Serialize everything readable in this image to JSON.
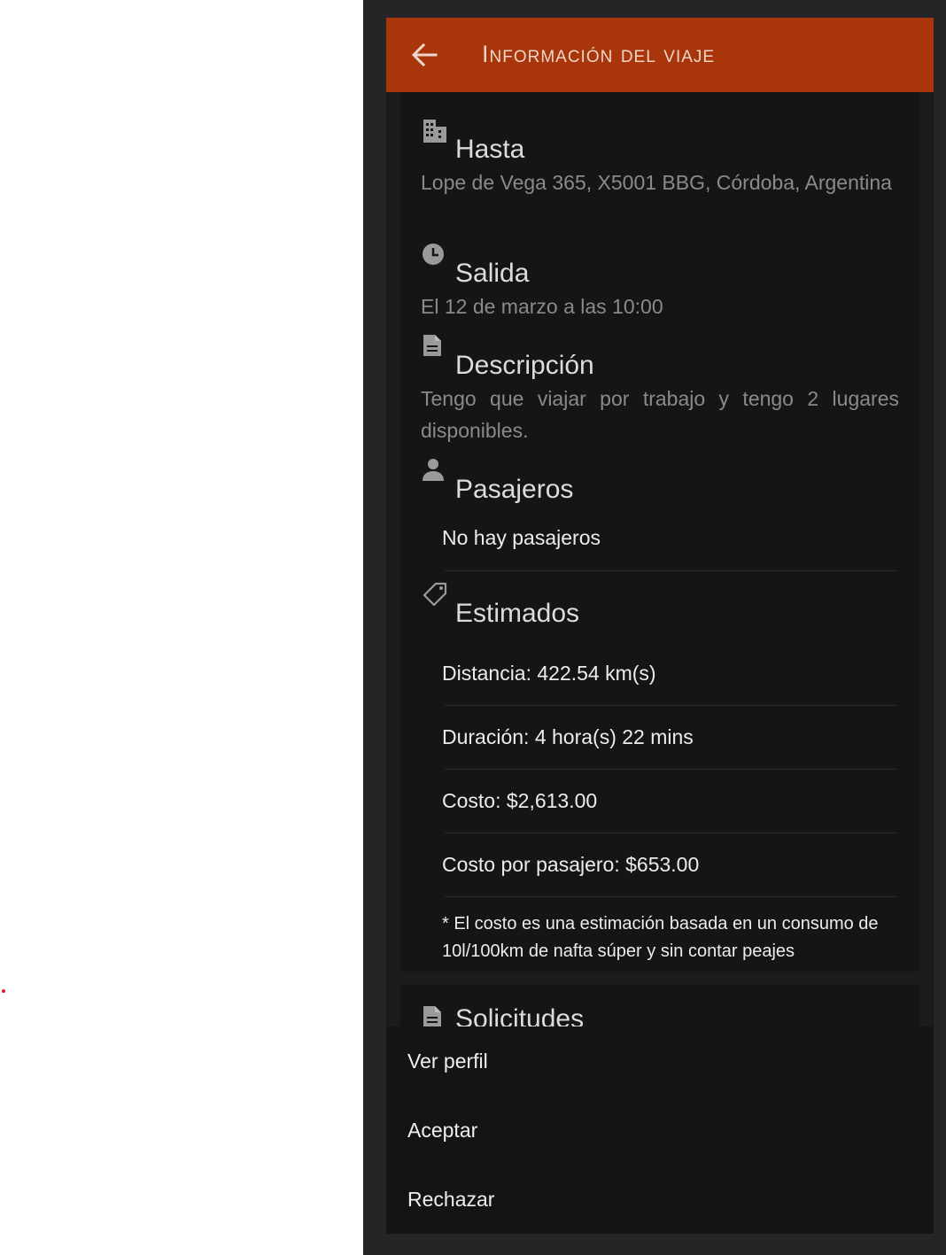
{
  "header": {
    "title": "Información del viaje",
    "back_icon": "arrow-left-icon"
  },
  "destination": {
    "heading": "Hasta",
    "icon": "building-icon",
    "address": "Lope de Vega 365, X5001 BBG, Córdoba, Argentina"
  },
  "departure": {
    "heading": "Salida",
    "icon": "clock-icon",
    "value": "El 12 de marzo a las 10:00"
  },
  "description": {
    "heading": "Descripción",
    "icon": "document-icon",
    "text": "Tengo que viajar por trabajo y tengo 2 lugares disponibles."
  },
  "passengers": {
    "heading": "Pasajeros",
    "icon": "person-icon",
    "empty_text": "No hay pasajeros"
  },
  "estimates": {
    "heading": "Estimados",
    "icon": "tag-icon",
    "items": [
      "Distancia: 422.54 km(s)",
      "Duración: 4 hora(s) 22 mins",
      "Costo: $2,613.00",
      "Costo por pasajero: $653.00"
    ],
    "note": "* El costo es una estimación basada en un consumo de 10l/100km de nafta súper y sin contar peajes"
  },
  "requests": {
    "heading": "Solicitudes",
    "icon": "document-icon"
  },
  "action_sheet": {
    "items": [
      "Ver perfil",
      "Aceptar",
      "Rechazar"
    ]
  },
  "colors": {
    "toolbar": "#a8360a",
    "background": "#1b1b1b",
    "card": "#151515"
  }
}
